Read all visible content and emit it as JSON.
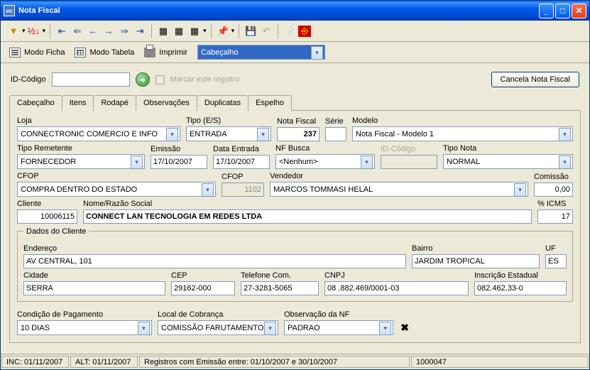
{
  "window": {
    "title": "Nota Fiscal"
  },
  "modebar": {
    "ficha": "Modo Ficha",
    "tabela": "Modo Tabela",
    "imprimir": "Imprimir",
    "dropdown": "Cabeçalho"
  },
  "idrow": {
    "label": "ID-Código",
    "value": "",
    "marcar": "Marcar este registro",
    "cancela": "Cancela Nota Fiscal"
  },
  "tabs": [
    "Cabeçalho",
    "Itens",
    "Rodapé",
    "Observações",
    "Duplicatas",
    "Espelho"
  ],
  "form": {
    "loja_label": "Loja",
    "loja": "CONNECTRONIC COMERCIO E INFO",
    "tipo_es_label": "Tipo (E/S)",
    "tipo_es": "ENTRADA",
    "nf_label": "Nota Fiscal",
    "nf": "237",
    "serie_label": "Série",
    "serie": "",
    "modelo_label": "Modelo",
    "modelo": "Nota Fiscal - Modelo 1",
    "tipo_rem_label": "Tipo Remetente",
    "tipo_rem": "FORNECEDOR",
    "emissao_label": "Emissão",
    "emissao": "17/10/2007",
    "data_ent_label": "Data Entrada",
    "data_ent": "17/10/2007",
    "nf_busca_label": "NF Busca",
    "nf_busca": "<Nenhum>",
    "idcodigo_label": "ID-Código",
    "idcodigo": "",
    "tipo_nota_label": "Tipo Nota",
    "tipo_nota": "NORMAL",
    "cfop_label": "CFOP",
    "cfop": "COMPRA DENTRO DO ESTADO",
    "cfop2_label": "CFOP",
    "cfop2": "1102",
    "vendedor_label": "Vendedor",
    "vendedor": "MARCOS TOMMASI HELAL",
    "comissao_label": "Comissão",
    "comissao": "0,00",
    "cliente_label": "Cliente",
    "cliente": "10006115",
    "razao_label": "Nome/Razão Social",
    "razao": "CONNECT LAN TECNOLOGIA EM REDES LTDA",
    "icms_label": "% ICMS",
    "icms": "17"
  },
  "dados": {
    "legend": "Dados do Cliente",
    "endereco_label": "Endereço",
    "endereco": "AV CENTRAL, 101",
    "bairro_label": "Bairro",
    "bairro": "JARDIM TROPICAL",
    "uf_label": "UF",
    "uf": "ES",
    "cidade_label": "Cidade",
    "cidade": "SERRA",
    "cep_label": "CEP",
    "cep": "29162-000",
    "tel_label": "Telefone Com.",
    "tel": "27-3281-5065",
    "cnpj_label": "CNPJ",
    "cnpj": "08 .882.469/0001-03",
    "ie_label": "Inscrição Estadual",
    "ie": "082.462.33-0"
  },
  "bottom": {
    "cond_label": "Condição de Pagamento",
    "cond": "10 DIAS",
    "local_label": "Local de Cobrança",
    "local": "COMISSÃO FARUTAMENTO",
    "obs_label": "Observação da NF",
    "obs": "PADRAO"
  },
  "status": {
    "inc": "INC: 01/11/2007",
    "alt": "ALT: 01/11/2007",
    "reg": "Registros com Emissão entre: 01/10/2007 e 30/10/2007",
    "num": "1000047"
  }
}
